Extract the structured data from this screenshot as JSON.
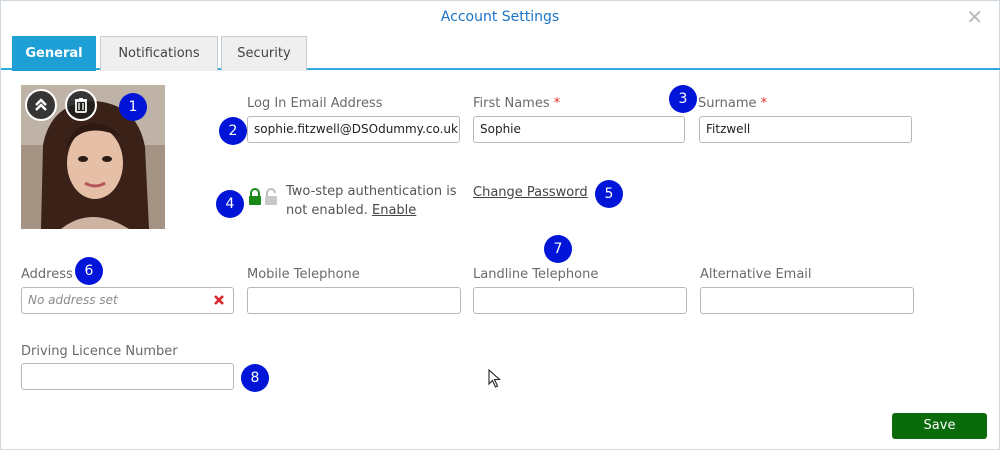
{
  "dialog": {
    "title": "Account Settings"
  },
  "tabs": [
    {
      "label": "General",
      "active": true
    },
    {
      "label": "Notifications",
      "active": false
    },
    {
      "label": "Security",
      "active": false
    }
  ],
  "avatar": {
    "icons": [
      "chevron-up-icon",
      "trash-icon"
    ]
  },
  "fields": {
    "email": {
      "label": "Log In Email Address",
      "value": "sophie.fitzwell@DSOdummy.co.uk"
    },
    "first_names": {
      "label": "First Names",
      "required": "*",
      "value": "Sophie"
    },
    "surname": {
      "label": "Surname",
      "required": "*",
      "value": "Fitzwell"
    },
    "address": {
      "label": "Address",
      "placeholder": "No address set"
    },
    "mobile": {
      "label": "Mobile Telephone",
      "value": ""
    },
    "landline": {
      "label": "Landline Telephone",
      "value": ""
    },
    "alt_email": {
      "label": "Alternative Email",
      "value": ""
    },
    "licence": {
      "label": "Driving Licence Number",
      "value": ""
    }
  },
  "two_step": {
    "text_line1": "Two-step authentication is",
    "text_line2": "not enabled.",
    "enable_link": "Enable",
    "icons": [
      "lock-icon-green",
      "unlock-icon-grey"
    ]
  },
  "change_password": "Change Password",
  "save_label": "Save",
  "badges": [
    "1",
    "2",
    "3",
    "4",
    "5",
    "6",
    "7",
    "8"
  ],
  "colors": {
    "accent": "#1e9fd6",
    "title": "#1a73c7",
    "save": "#0a6b0a",
    "badge": "#0015d8",
    "required": "#d9342b"
  }
}
